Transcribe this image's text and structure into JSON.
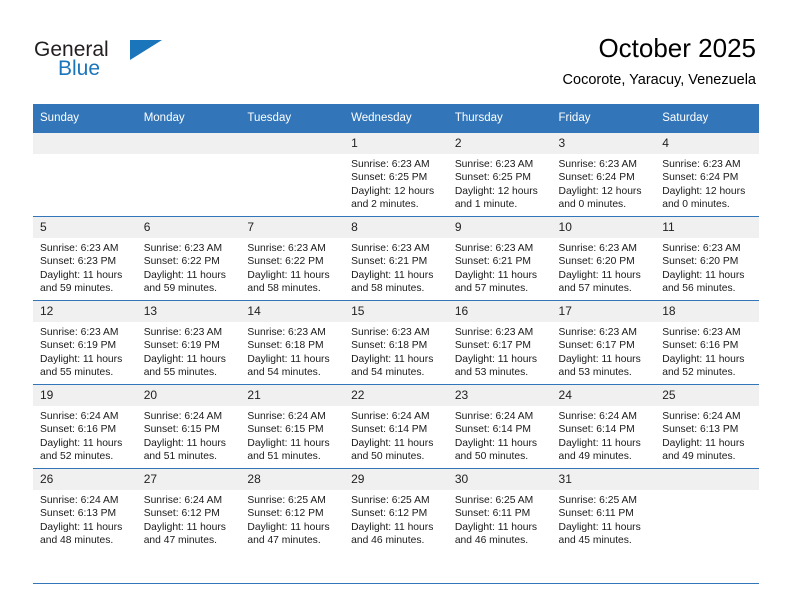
{
  "brand": {
    "name_top": "General",
    "name_bottom": "Blue",
    "accent_color": "#1b75bb"
  },
  "header": {
    "title": "October 2025",
    "subtitle": "Cocorote, Yaracuy, Venezuela"
  },
  "theme": {
    "header_row_bg": "#3275b8",
    "header_row_text": "#ffffff",
    "daynum_bg": "#f0f0f0",
    "grid_line": "#3275b8"
  },
  "weekdays": [
    "Sunday",
    "Monday",
    "Tuesday",
    "Wednesday",
    "Thursday",
    "Friday",
    "Saturday"
  ],
  "labels": {
    "sunrise_prefix": "Sunrise:",
    "sunset_prefix": "Sunset:",
    "daylight_prefix": "Daylight:"
  },
  "weeks": [
    [
      {
        "day": "",
        "empty": true
      },
      {
        "day": "",
        "empty": true
      },
      {
        "day": "",
        "empty": true
      },
      {
        "day": "1",
        "sunrise": "Sunrise: 6:23 AM",
        "sunset": "Sunset: 6:25 PM",
        "daylight_l1": "Daylight: 12 hours",
        "daylight_l2": "and 2 minutes."
      },
      {
        "day": "2",
        "sunrise": "Sunrise: 6:23 AM",
        "sunset": "Sunset: 6:25 PM",
        "daylight_l1": "Daylight: 12 hours",
        "daylight_l2": "and 1 minute."
      },
      {
        "day": "3",
        "sunrise": "Sunrise: 6:23 AM",
        "sunset": "Sunset: 6:24 PM",
        "daylight_l1": "Daylight: 12 hours",
        "daylight_l2": "and 0 minutes."
      },
      {
        "day": "4",
        "sunrise": "Sunrise: 6:23 AM",
        "sunset": "Sunset: 6:24 PM",
        "daylight_l1": "Daylight: 12 hours",
        "daylight_l2": "and 0 minutes."
      }
    ],
    [
      {
        "day": "5",
        "sunrise": "Sunrise: 6:23 AM",
        "sunset": "Sunset: 6:23 PM",
        "daylight_l1": "Daylight: 11 hours",
        "daylight_l2": "and 59 minutes."
      },
      {
        "day": "6",
        "sunrise": "Sunrise: 6:23 AM",
        "sunset": "Sunset: 6:22 PM",
        "daylight_l1": "Daylight: 11 hours",
        "daylight_l2": "and 59 minutes."
      },
      {
        "day": "7",
        "sunrise": "Sunrise: 6:23 AM",
        "sunset": "Sunset: 6:22 PM",
        "daylight_l1": "Daylight: 11 hours",
        "daylight_l2": "and 58 minutes."
      },
      {
        "day": "8",
        "sunrise": "Sunrise: 6:23 AM",
        "sunset": "Sunset: 6:21 PM",
        "daylight_l1": "Daylight: 11 hours",
        "daylight_l2": "and 58 minutes."
      },
      {
        "day": "9",
        "sunrise": "Sunrise: 6:23 AM",
        "sunset": "Sunset: 6:21 PM",
        "daylight_l1": "Daylight: 11 hours",
        "daylight_l2": "and 57 minutes."
      },
      {
        "day": "10",
        "sunrise": "Sunrise: 6:23 AM",
        "sunset": "Sunset: 6:20 PM",
        "daylight_l1": "Daylight: 11 hours",
        "daylight_l2": "and 57 minutes."
      },
      {
        "day": "11",
        "sunrise": "Sunrise: 6:23 AM",
        "sunset": "Sunset: 6:20 PM",
        "daylight_l1": "Daylight: 11 hours",
        "daylight_l2": "and 56 minutes."
      }
    ],
    [
      {
        "day": "12",
        "sunrise": "Sunrise: 6:23 AM",
        "sunset": "Sunset: 6:19 PM",
        "daylight_l1": "Daylight: 11 hours",
        "daylight_l2": "and 55 minutes."
      },
      {
        "day": "13",
        "sunrise": "Sunrise: 6:23 AM",
        "sunset": "Sunset: 6:19 PM",
        "daylight_l1": "Daylight: 11 hours",
        "daylight_l2": "and 55 minutes."
      },
      {
        "day": "14",
        "sunrise": "Sunrise: 6:23 AM",
        "sunset": "Sunset: 6:18 PM",
        "daylight_l1": "Daylight: 11 hours",
        "daylight_l2": "and 54 minutes."
      },
      {
        "day": "15",
        "sunrise": "Sunrise: 6:23 AM",
        "sunset": "Sunset: 6:18 PM",
        "daylight_l1": "Daylight: 11 hours",
        "daylight_l2": "and 54 minutes."
      },
      {
        "day": "16",
        "sunrise": "Sunrise: 6:23 AM",
        "sunset": "Sunset: 6:17 PM",
        "daylight_l1": "Daylight: 11 hours",
        "daylight_l2": "and 53 minutes."
      },
      {
        "day": "17",
        "sunrise": "Sunrise: 6:23 AM",
        "sunset": "Sunset: 6:17 PM",
        "daylight_l1": "Daylight: 11 hours",
        "daylight_l2": "and 53 minutes."
      },
      {
        "day": "18",
        "sunrise": "Sunrise: 6:23 AM",
        "sunset": "Sunset: 6:16 PM",
        "daylight_l1": "Daylight: 11 hours",
        "daylight_l2": "and 52 minutes."
      }
    ],
    [
      {
        "day": "19",
        "sunrise": "Sunrise: 6:24 AM",
        "sunset": "Sunset: 6:16 PM",
        "daylight_l1": "Daylight: 11 hours",
        "daylight_l2": "and 52 minutes."
      },
      {
        "day": "20",
        "sunrise": "Sunrise: 6:24 AM",
        "sunset": "Sunset: 6:15 PM",
        "daylight_l1": "Daylight: 11 hours",
        "daylight_l2": "and 51 minutes."
      },
      {
        "day": "21",
        "sunrise": "Sunrise: 6:24 AM",
        "sunset": "Sunset: 6:15 PM",
        "daylight_l1": "Daylight: 11 hours",
        "daylight_l2": "and 51 minutes."
      },
      {
        "day": "22",
        "sunrise": "Sunrise: 6:24 AM",
        "sunset": "Sunset: 6:14 PM",
        "daylight_l1": "Daylight: 11 hours",
        "daylight_l2": "and 50 minutes."
      },
      {
        "day": "23",
        "sunrise": "Sunrise: 6:24 AM",
        "sunset": "Sunset: 6:14 PM",
        "daylight_l1": "Daylight: 11 hours",
        "daylight_l2": "and 50 minutes."
      },
      {
        "day": "24",
        "sunrise": "Sunrise: 6:24 AM",
        "sunset": "Sunset: 6:14 PM",
        "daylight_l1": "Daylight: 11 hours",
        "daylight_l2": "and 49 minutes."
      },
      {
        "day": "25",
        "sunrise": "Sunrise: 6:24 AM",
        "sunset": "Sunset: 6:13 PM",
        "daylight_l1": "Daylight: 11 hours",
        "daylight_l2": "and 49 minutes."
      }
    ],
    [
      {
        "day": "26",
        "sunrise": "Sunrise: 6:24 AM",
        "sunset": "Sunset: 6:13 PM",
        "daylight_l1": "Daylight: 11 hours",
        "daylight_l2": "and 48 minutes."
      },
      {
        "day": "27",
        "sunrise": "Sunrise: 6:24 AM",
        "sunset": "Sunset: 6:12 PM",
        "daylight_l1": "Daylight: 11 hours",
        "daylight_l2": "and 47 minutes."
      },
      {
        "day": "28",
        "sunrise": "Sunrise: 6:25 AM",
        "sunset": "Sunset: 6:12 PM",
        "daylight_l1": "Daylight: 11 hours",
        "daylight_l2": "and 47 minutes."
      },
      {
        "day": "29",
        "sunrise": "Sunrise: 6:25 AM",
        "sunset": "Sunset: 6:12 PM",
        "daylight_l1": "Daylight: 11 hours",
        "daylight_l2": "and 46 minutes."
      },
      {
        "day": "30",
        "sunrise": "Sunrise: 6:25 AM",
        "sunset": "Sunset: 6:11 PM",
        "daylight_l1": "Daylight: 11 hours",
        "daylight_l2": "and 46 minutes."
      },
      {
        "day": "31",
        "sunrise": "Sunrise: 6:25 AM",
        "sunset": "Sunset: 6:11 PM",
        "daylight_l1": "Daylight: 11 hours",
        "daylight_l2": "and 45 minutes."
      },
      {
        "day": "",
        "empty": true
      }
    ]
  ]
}
